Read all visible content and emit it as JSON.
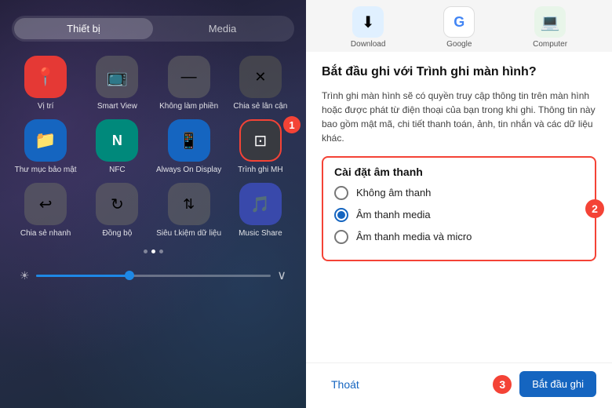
{
  "left": {
    "tabs": [
      {
        "label": "Thiết bị",
        "active": true
      },
      {
        "label": "Media",
        "active": false
      }
    ],
    "icons": [
      {
        "id": "vi-tri",
        "label": "Vị trí",
        "color": "ic-red",
        "icon": "📍",
        "highlight": false
      },
      {
        "id": "smart-view",
        "label": "Smart View",
        "color": "ic-gray",
        "icon": "📺",
        "highlight": false
      },
      {
        "id": "khong-lam-phien",
        "label": "Không làm phiền",
        "color": "ic-gray",
        "icon": "🚫",
        "highlight": false
      },
      {
        "id": "chia-se-lan-can",
        "label": "Chia sẻ lân cận",
        "color": "ic-darkgray",
        "icon": "✕",
        "highlight": false
      },
      {
        "id": "thu-muc-bao-mat",
        "label": "Thư mục bảo mật",
        "color": "ic-blue",
        "icon": "📁",
        "highlight": false
      },
      {
        "id": "nfc",
        "label": "NFC",
        "color": "ic-teal",
        "icon": "N",
        "highlight": false
      },
      {
        "id": "always-on-display",
        "label": "Always On Display",
        "color": "ic-blue",
        "icon": "📋",
        "highlight": false
      },
      {
        "id": "trinh-ghi-mh",
        "label": "Trình ghi MH",
        "color": "ic-dark",
        "icon": "⊡",
        "highlight": true
      },
      {
        "id": "chia-se-nhanh",
        "label": "Chia sẻ nhanh",
        "color": "ic-gray",
        "icon": "↩",
        "highlight": false
      },
      {
        "id": "dong-bo",
        "label": "Đồng bộ",
        "color": "ic-gray",
        "icon": "↻",
        "highlight": false
      },
      {
        "id": "sieu-tiet-kiem",
        "label": "Siêu t.kiệm dữ liệu",
        "color": "ic-gray",
        "icon": "≬",
        "highlight": false
      },
      {
        "id": "music-share",
        "label": "Music Share",
        "color": "ic-indigo",
        "icon": "🎵",
        "highlight": false
      }
    ],
    "dots": [
      false,
      true,
      false
    ],
    "badge_1": "1"
  },
  "right": {
    "top_apps": [
      {
        "label": "Download",
        "icon": "⬇",
        "bg": "#e0f0ff"
      },
      {
        "label": "Google",
        "icon": "G",
        "bg": "#fff"
      },
      {
        "label": "Computer",
        "icon": "💻",
        "bg": "#e8f5e9"
      }
    ],
    "dialog_title": "Bắt đầu ghi với Trình ghi màn hình?",
    "dialog_desc": "Trình ghi màn hình sẽ có quyền truy cập thông tin trên màn hình hoặc được phát từ điện thoại của bạn trong khi ghi. Thông tin này bao gồm mật mã, chi tiết thanh toán, ảnh, tin nhắn và các dữ liệu khác.",
    "audio_section_title": "Cài đặt âm thanh",
    "audio_options": [
      {
        "id": "no-sound",
        "label": "Không âm thanh",
        "selected": false
      },
      {
        "id": "media-sound",
        "label": "Âm thanh media",
        "selected": true
      },
      {
        "id": "media-mic",
        "label": "Âm thanh media và micro",
        "selected": false
      }
    ],
    "badge_2": "2",
    "badge_3": "3",
    "btn_cancel": "Thoát",
    "btn_start": "Bắt đầu ghi"
  }
}
